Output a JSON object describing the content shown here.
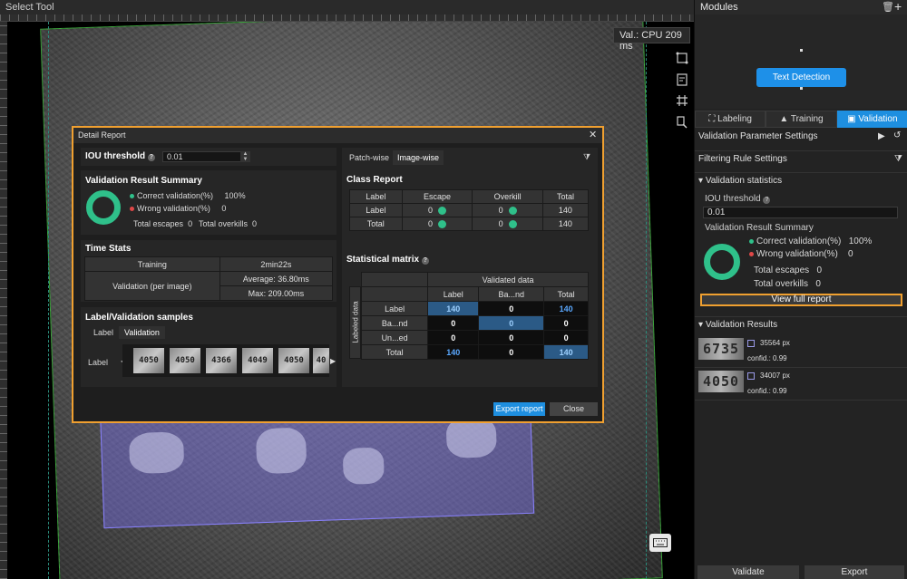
{
  "canvas": {
    "tool_title": "Select Tool",
    "val_readout": "Val.: CPU 209 ms",
    "tool_icons": [
      "polygon-select-icon",
      "clipboard-check-icon",
      "grid-hash-icon",
      "brush-layer-icon"
    ],
    "keyboard_icon": "keyboard-icon"
  },
  "modules": {
    "title": "Modules",
    "node_label": "Text Detection"
  },
  "tabs": [
    {
      "label": "Labeling",
      "icon": "labeling-icon"
    },
    {
      "label": "Training",
      "icon": "training-icon"
    },
    {
      "label": "Validation",
      "icon": "validation-icon"
    }
  ],
  "right_panel": {
    "validation_parameter_settings": "Validation Parameter Settings",
    "filtering_rule_settings": "Filtering Rule Settings",
    "validation_statistics": "Validation statistics",
    "iou_label": "IOU threshold",
    "iou_value": "0.01",
    "summary_title": "Validation Result Summary",
    "correct": "Correct validation(%)",
    "correct_value": "100%",
    "wrong": "Wrong validation(%)",
    "wrong_value": "0",
    "total_escapes": "Total escapes",
    "total_escapes_value": "0",
    "total_overkills": "Total overkills",
    "total_overkills_value": "0",
    "view_full_report": "View full report",
    "validation_results": "Validation Results",
    "results": [
      {
        "thumb_text": "6735",
        "size": "35564 px",
        "confidence": "confid.: 0.99"
      },
      {
        "thumb_text": "4050",
        "size": "34007 px",
        "confidence": "confid.: 0.99"
      }
    ],
    "validate_label": "Validate",
    "export_label": "Export"
  },
  "dialog": {
    "title": "Detail Report",
    "iou_title": "IOU threshold",
    "iou_value": "0.01",
    "summary_title": "Validation Result Summary",
    "correct_label": "Correct validation(%)",
    "correct_value": "100%",
    "wrong_label": "Wrong validation(%)",
    "wrong_value": "0",
    "total_escapes": "Total escapes",
    "total_escapes_value": "0",
    "total_overkills": "Total overkills",
    "total_overkills_value": "0",
    "colors": {
      "correct": "#2fc08a",
      "wrong": "#e04848"
    },
    "time_stats": {
      "title": "Time Stats",
      "training_label": "Training",
      "training_value": "2min22s",
      "validation_label": "Validation (per image)",
      "average": "Average: 36.80ms",
      "max": "Max: 209.00ms"
    },
    "samples": {
      "title": "Label/Validation samples",
      "tab_label": "Label",
      "tab_validation": "Validation",
      "row_label": "Label",
      "thumbs": [
        "4050",
        "4050",
        "4366",
        "4049",
        "4050",
        "40"
      ]
    },
    "view_tabs": {
      "patch": "Patch-wise",
      "image": "Image-wise"
    },
    "class_report": {
      "title": "Class Report",
      "headers": [
        "Label",
        "Escape",
        "Overkill",
        "Total"
      ],
      "rows": [
        {
          "label": "Label",
          "escape": "0",
          "overkill": "0",
          "total": "140"
        },
        {
          "label": "Total",
          "escape": "0",
          "overkill": "0",
          "total": "140"
        }
      ]
    },
    "statistical_matrix": {
      "title": "Statistical matrix",
      "validated_header": "Validated data",
      "labeled_header": "Labeled data",
      "col_headers": [
        "Label",
        "Ba...nd",
        "Total"
      ],
      "rows": [
        {
          "name": "Label",
          "values": [
            "140",
            "0",
            "140"
          ]
        },
        {
          "name": "Ba...nd",
          "values": [
            "0",
            "0",
            "0"
          ]
        },
        {
          "name": "Un...ed",
          "values": [
            "0",
            "0",
            "0"
          ]
        },
        {
          "name": "Total",
          "values": [
            "140",
            "0",
            "140"
          ]
        }
      ]
    },
    "export_report": "Export report",
    "close": "Close"
  }
}
